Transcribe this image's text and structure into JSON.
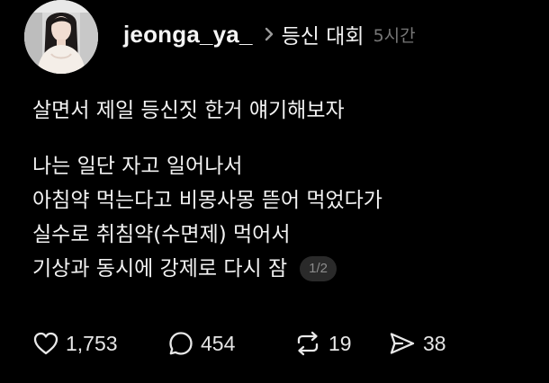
{
  "post": {
    "username": "jeonga_ya_",
    "topic": "등신 대회",
    "time": "5시간",
    "paragraphs": [
      [
        "살면서 제일 등신짓 한거 얘기해보자"
      ],
      [
        "나는 일단 자고 일어나서",
        "아침약 먹는다고 비몽사몽 뜯어 먹었다가",
        "실수로 취침약(수면제) 먹어서",
        "기상과 동시에 강제로 다시 잠"
      ]
    ],
    "page_indicator": "1/2",
    "actions": {
      "likes": "1,753",
      "replies": "454",
      "reposts": "19",
      "shares": "38"
    }
  },
  "icons": {
    "avatar": "profile-photo",
    "chevron": "chevron-right-icon",
    "like": "heart-icon",
    "reply": "speech-bubble-icon",
    "repost": "repost-arrows-icon",
    "share": "paper-plane-icon"
  },
  "colors": {
    "background": "#000000",
    "text": "#f3f3f3",
    "muted": "#777777",
    "badge_bg": "#2a2a2a"
  }
}
